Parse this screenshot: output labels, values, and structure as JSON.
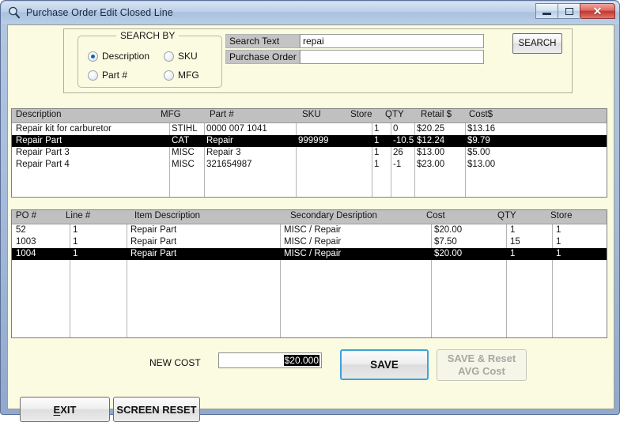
{
  "window": {
    "title": "Purchase Order Edit Closed Line",
    "icon": "magnifier-icon",
    "minimize_label": "",
    "maximize_label": "",
    "close_label": "✕"
  },
  "search_panel": {
    "group_legend": "SEARCH BY",
    "options": [
      {
        "label": "Description",
        "selected": true
      },
      {
        "label": "SKU",
        "selected": false
      },
      {
        "label": "Part #",
        "selected": false
      },
      {
        "label": "MFG",
        "selected": false
      }
    ],
    "fields": [
      {
        "label": "Search Text",
        "value": "repai",
        "placeholder": ""
      },
      {
        "label": "Purchase Order",
        "value": "",
        "placeholder": ""
      }
    ],
    "search_button": "SEARCH"
  },
  "item_grid": {
    "columns": [
      "Description",
      "MFG",
      "Part #",
      "SKU",
      "Store",
      "QTY",
      "Retail $",
      "Cost$"
    ],
    "rows": [
      {
        "selected": false,
        "cells": [
          "Repair kit for carburetor",
          "STIHL",
          "0000 007 1041",
          "",
          "",
          "1",
          "0",
          "$20.25",
          "$13.16"
        ]
      },
      {
        "selected": true,
        "cells": [
          "Repair Part",
          "CAT",
          "Repair",
          "999999",
          "",
          "1",
          "-10.5",
          "$12.24",
          "$9.79"
        ]
      },
      {
        "selected": false,
        "cells": [
          "Repair Part 3",
          "MISC",
          "Repair 3",
          "",
          "",
          "1",
          "26",
          "$13.00",
          "$5.00"
        ]
      },
      {
        "selected": false,
        "cells": [
          "Repair Part 4",
          "MISC",
          "321654987",
          "",
          "",
          "1",
          "-1",
          "$23.00",
          "$13.00"
        ]
      }
    ]
  },
  "po_grid": {
    "columns": [
      "PO #",
      "Line #",
      "Item Description",
      "Secondary Desription",
      "Cost",
      "QTY",
      "Store"
    ],
    "rows": [
      {
        "selected": false,
        "cells": [
          "52",
          "1",
          "Repair Part",
          "MISC / Repair",
          "$20.00",
          "1",
          "1"
        ]
      },
      {
        "selected": false,
        "cells": [
          "1003",
          "1",
          "Repair Part",
          "MISC / Repair",
          "$7.50",
          "15",
          "1"
        ]
      },
      {
        "selected": true,
        "cells": [
          "1004",
          "1",
          "Repair Part",
          "MISC / Repair",
          "$20.00",
          "1",
          "1"
        ]
      }
    ]
  },
  "footer": {
    "new_cost_label": "NEW COST",
    "new_cost_value": "$20.000",
    "save_label": "SAVE",
    "save_reset_line1": "SAVE & Reset",
    "save_reset_line2": "AVG Cost",
    "exit_label_prefix": "",
    "exit_accel": "E",
    "exit_label_suffix": "XIT",
    "screen_reset_label": "SCREEN RESET"
  },
  "colors": {
    "panel_bg": "#fbfbe2",
    "header_bg": "#c0c0c0",
    "selection_bg": "#000000",
    "accent_focus": "#3ca4d8",
    "radio_accent": "#1464b4"
  }
}
